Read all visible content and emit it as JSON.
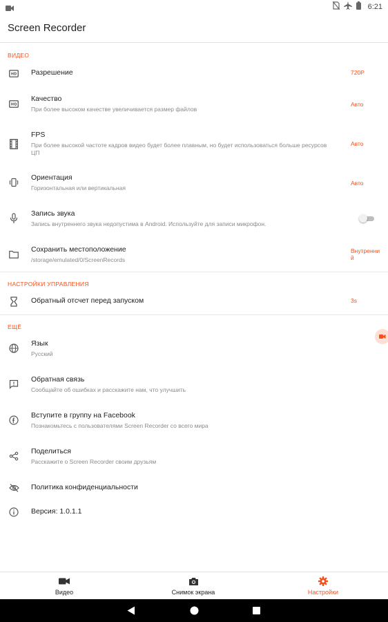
{
  "status_bar": {
    "time": "6:21",
    "left_icon": "video-camera-icon",
    "right_icons": [
      "no-sim-icon",
      "airplane-icon",
      "battery-icon"
    ]
  },
  "app_bar": {
    "title": "Screen Recorder"
  },
  "sections": {
    "video": {
      "header": "ВИДЕО",
      "resolution": {
        "icon": "hd-icon",
        "title": "Разрешение",
        "value": "720P"
      },
      "quality": {
        "icon": "hq-icon",
        "title": "Качество",
        "subtitle": "При более высоком качестве увеличивается размер файлов",
        "value": "Авто"
      },
      "fps": {
        "icon": "film-strip-icon",
        "title": "FPS",
        "subtitle": "При более высокой частоте кадров видео будет более плавным, но будет использоваться больше ресурсов ЦП",
        "value": "Авто"
      },
      "orientation": {
        "icon": "screen-rotation-icon",
        "title": "Ориентация",
        "subtitle": "Горизонтальная или вертикальная",
        "value": "Авто"
      },
      "audio": {
        "icon": "microphone-icon",
        "title": "Запись звука",
        "subtitle": "Запись внутреннего звука недопустима в Android. Используйте для записи микрофон.",
        "enabled": false
      },
      "location": {
        "icon": "folder-icon",
        "title": "Сохранить местоположение",
        "subtitle": "/storage/emulated/0/ScreenRecords",
        "value": "Внутренний"
      }
    },
    "controls": {
      "header": "НАСТРОЙКИ УПРАВЛЕНИЯ",
      "countdown": {
        "icon": "hourglass-icon",
        "title": "Обратный отсчет перед запуском",
        "value": "3s"
      }
    },
    "more": {
      "header": "ЕЩЁ",
      "language": {
        "icon": "globe-icon",
        "title": "Язык",
        "subtitle": "Русский"
      },
      "feedback": {
        "icon": "feedback-icon",
        "title": "Обратная связь",
        "subtitle": "Сообщайте об ошибках и расскажите нам, что улучшить"
      },
      "facebook": {
        "icon": "facebook-icon",
        "title": "Вступите в группу на Facebook",
        "subtitle": "Познакомьтесь с пользователями Screen Recorder со всего мира"
      },
      "share": {
        "icon": "share-icon",
        "title": "Поделиться",
        "subtitle": "Расскажите о Screen Recorder своим друзьям"
      },
      "privacy": {
        "icon": "eye-off-icon",
        "title": "Политика конфиденциальности"
      },
      "version": {
        "icon": "info-icon",
        "title": "Версия: 1.0.1.1"
      }
    }
  },
  "bottom_nav": {
    "items": [
      {
        "label": "Видео",
        "icon": "video-camera-icon"
      },
      {
        "label": "Снимок экрана",
        "icon": "camera-icon"
      },
      {
        "label": "Настройки",
        "icon": "gear-icon"
      }
    ],
    "active_index": 2
  },
  "colors": {
    "accent": "#f4511e",
    "text_primary": "#212121",
    "text_secondary": "#8a8a8a",
    "divider": "#e0e0e0",
    "nav_bar": "#000000"
  }
}
